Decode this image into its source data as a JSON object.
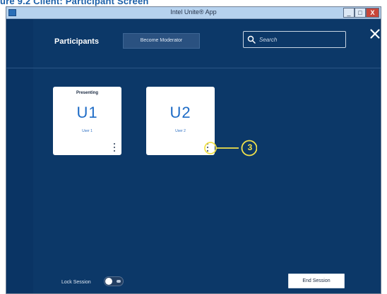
{
  "document": {
    "heading": "ure 9.2 Client: Participant Screen"
  },
  "window": {
    "title": "Intel Unite® App",
    "controls": {
      "minimize": "_",
      "maximize": "□",
      "close": "X"
    }
  },
  "header": {
    "title": "Participants",
    "moderator_button": "Become Moderator",
    "search": {
      "placeholder": "Search",
      "value": ""
    },
    "close_label": "✕"
  },
  "participants": [
    {
      "status": "Presenting",
      "initials": "U1",
      "name": "User 1"
    },
    {
      "status": "",
      "initials": "U2",
      "name": "User 2"
    }
  ],
  "callout": {
    "number": "3",
    "color": "#f2e24a"
  },
  "footer": {
    "lock_label": "Lock Session",
    "lock_session_on": false,
    "end_session_button": "End Session"
  },
  "colors": {
    "window_bg": "#0c3868",
    "accent_text": "#1d6bc6",
    "title_bar": "#b6d2ee",
    "close_button": "#c7463a"
  },
  "icons": {
    "search": "search-icon",
    "close": "close-icon",
    "tile_menu": "more-vertical-icon",
    "toggle": "toggle-icon",
    "app": "app-icon"
  }
}
